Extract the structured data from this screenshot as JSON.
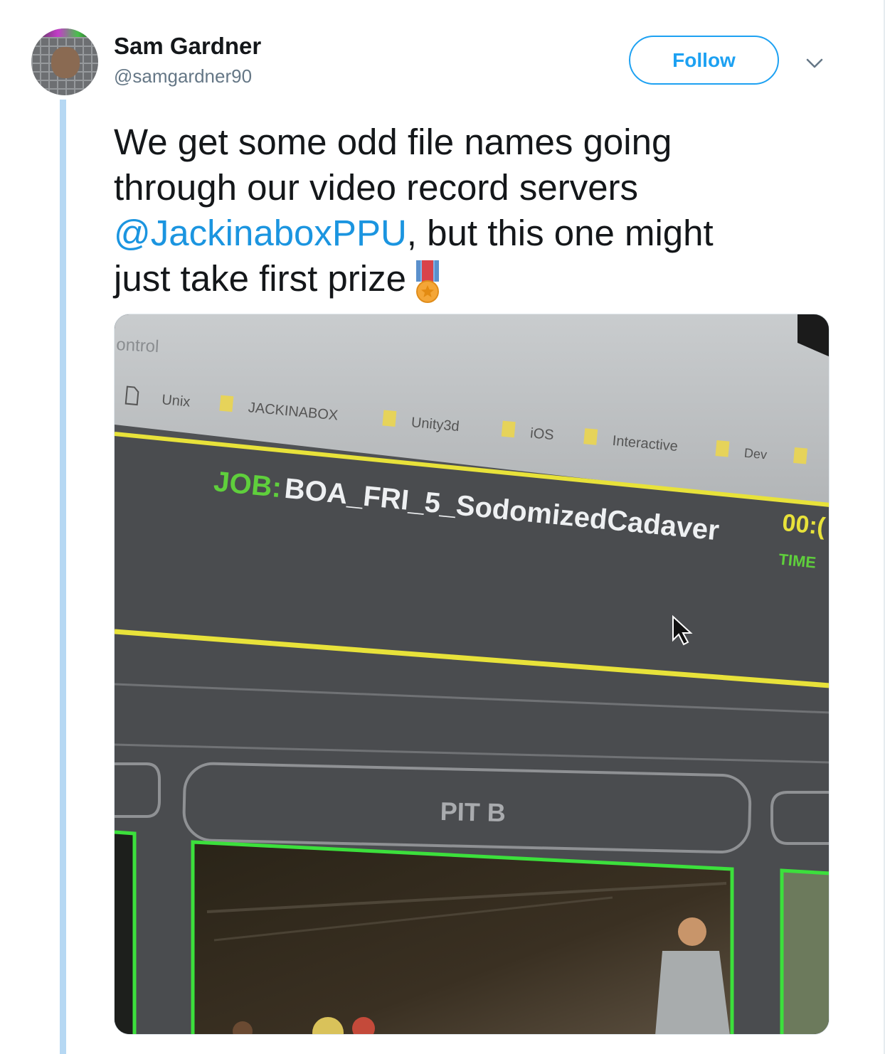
{
  "tweet": {
    "user": {
      "name": "Sam Gardner",
      "handle": "@samgardner90"
    },
    "follow_label": "Follow",
    "text": {
      "line1": "We get some odd file names going",
      "line2": "through our video record servers",
      "mention": "@JackinaboxPPU",
      "line3_rest": ", but this one might",
      "line4": "just take first prize"
    },
    "medal_icon": "military-medal-icon"
  },
  "photo": {
    "window_title_fragment": "ontrol",
    "bookmarks": [
      "Unix",
      "JACKINABOX",
      "Unity3d",
      "iOS",
      "Interactive",
      "Dev"
    ],
    "job_label": "JOB:",
    "job_name": "BOA_FRI_5_SodomizedCadaver",
    "timer": "00:(",
    "time_label": "TIME",
    "pit_label": "PIT B"
  },
  "colors": {
    "link": "#1b95e0",
    "follow": "#1da1f2",
    "thread_line": "#b6d8f3",
    "job_green": "#5fcf3c",
    "highlight_yellow": "#e8e23a",
    "frame_green": "#3ce03c"
  }
}
